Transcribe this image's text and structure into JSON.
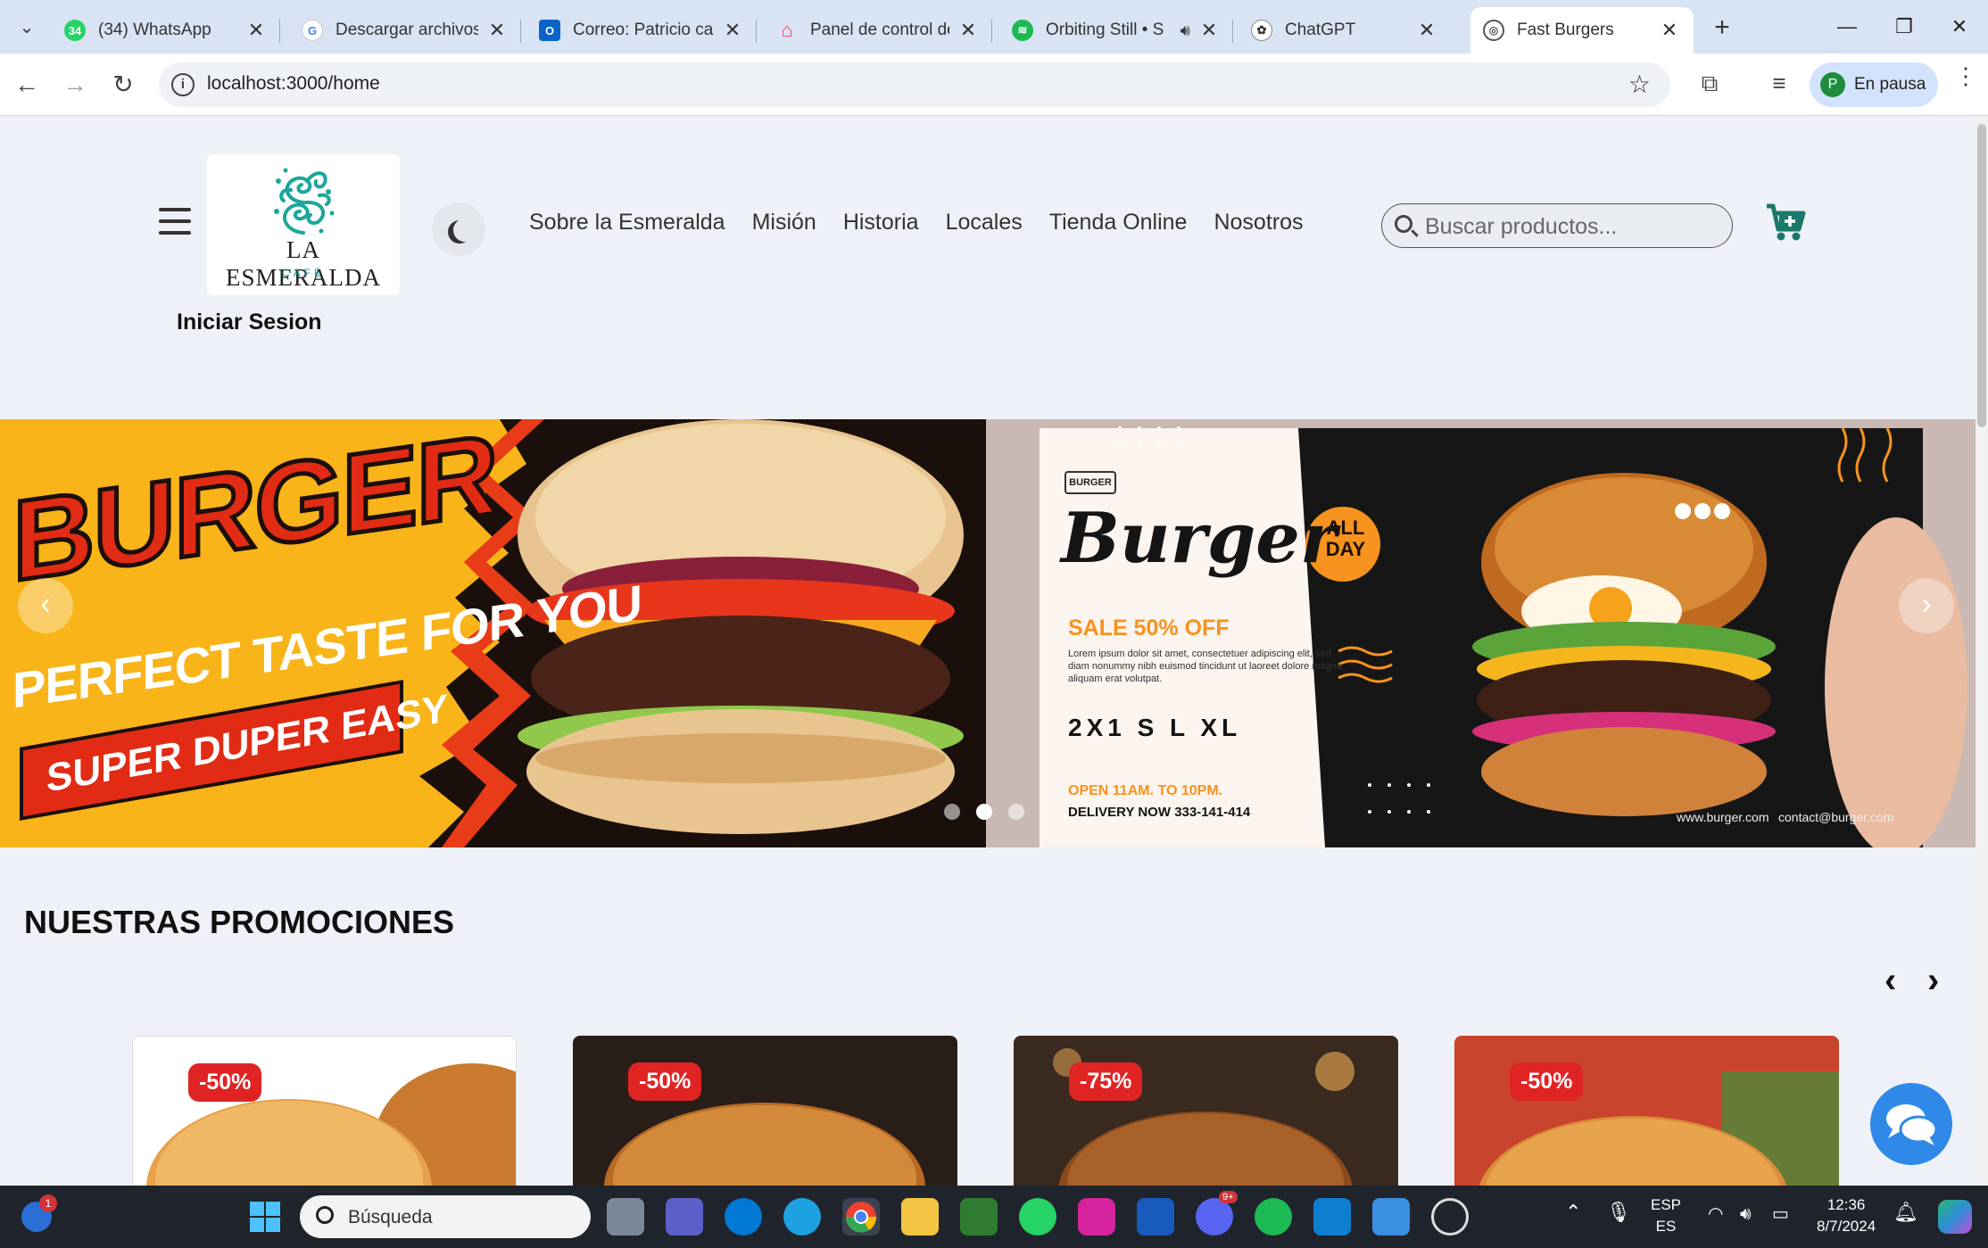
{
  "browser": {
    "tabs": [
      {
        "title": "(34) WhatsApp",
        "favicon": "whatsapp-icon",
        "color": "#25d366",
        "badge": "34",
        "active": false
      },
      {
        "title": "Descargar archivos",
        "favicon": "google-icon",
        "color": "#4285f4",
        "active": false
      },
      {
        "title": "Correo: Patricio cala",
        "favicon": "outlook-icon",
        "color": "#0a64c8",
        "active": false
      },
      {
        "title": "Panel de control del",
        "favicon": "airbnb-icon",
        "color": "#ff385c",
        "active": false
      },
      {
        "title": "Orbiting Still • S",
        "favicon": "spotify-icon",
        "color": "#1db954",
        "active": false,
        "audio": true
      },
      {
        "title": "ChatGPT",
        "favicon": "chatgpt-icon",
        "color": "#333333",
        "active": false
      },
      {
        "title": "Fast Burgers",
        "favicon": "globe-icon",
        "color": "#555555",
        "active": true
      }
    ],
    "url": "localhost:3000/home",
    "profile_initial": "P",
    "profile_label": "En pausa"
  },
  "header": {
    "logo_name": "LA ESMERALDA",
    "logo_sub": "CAFÉ",
    "login": "Iniciar Sesion",
    "nav": [
      "Sobre la Esmeralda",
      "Misión",
      "Historia",
      "Locales",
      "Tienda Online",
      "Nosotros"
    ],
    "search_placeholder": "Buscar productos...",
    "accent": "#1a8a7a"
  },
  "carousel": {
    "slide1": {
      "headline": "BURGER",
      "tagline": "PERFECT TASTE FOR YOU",
      "ribbon": "SUPER DUPER EASY"
    },
    "slide2": {
      "brand_badge": "BURGER",
      "title": "Burger",
      "all_day": [
        "ALL",
        "DAY"
      ],
      "sale": "SALE 50% OFF",
      "lorem": "Lorem ipsum dolor sit amet, consectetuer adipiscing elit, sed diam nonummy nibh euismod tincidunt ut laoreet dolore magna aliquam erat volutpat.",
      "sizes": "2X1 S L XL",
      "hours": "OPEN 11AM. TO 10PM.",
      "delivery_label": "DELIVERY NOW",
      "phone": "333-141-414",
      "site": "www.burger.com",
      "email": "contact@burger.com"
    },
    "dots": 3,
    "active_dot": 1
  },
  "promotions": {
    "title": "NUESTRAS PROMOCIONES",
    "cards": [
      {
        "discount": "-50%",
        "bg": "#ffffff"
      },
      {
        "discount": "-50%",
        "bg": "#2a1e18"
      },
      {
        "discount": "-75%",
        "bg": "#3a2a20"
      },
      {
        "discount": "-50%",
        "bg": "#c9442c"
      }
    ]
  },
  "taskbar": {
    "search_placeholder": "Búsqueda",
    "notification_badge": "1",
    "discord_badge": "9+",
    "lang": "ESP",
    "lang_sub": "ES",
    "time": "12:36",
    "date": "8/7/2024"
  }
}
